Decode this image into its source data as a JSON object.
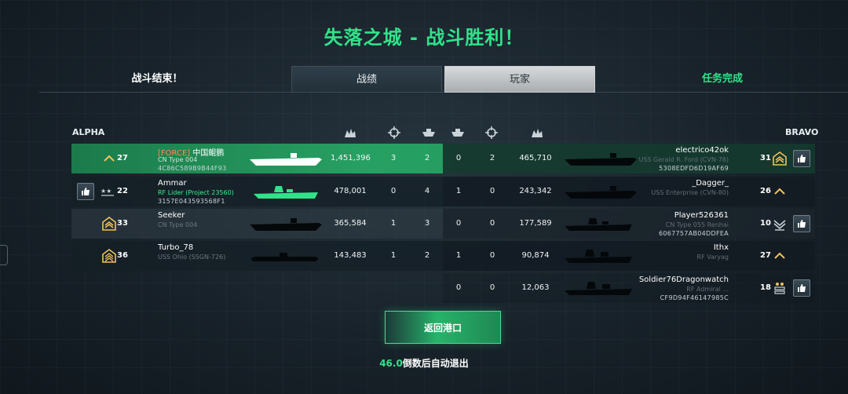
{
  "title": "失落之城 - 战斗胜利！",
  "tabs": {
    "battle_over": "战斗结束！",
    "stats": "战绩",
    "players": "玩家",
    "mission_complete": "任务完成"
  },
  "teams": {
    "alpha": "ALPHA",
    "bravo": "BRAVO"
  },
  "columns_icons": [
    "damage-icon",
    "crosshair-icon",
    "ship-icon",
    "ship-icon",
    "crosshair-icon",
    "damage-icon"
  ],
  "rows": [
    {
      "left": {
        "level": "27",
        "clan": "[FORCE]",
        "name": "中国鲲鹏",
        "ship": "CN Type 004",
        "id": "4C86C589B9B44F93",
        "damage": "1,451,396",
        "kills": "3",
        "assists": "2"
      },
      "right": {
        "assists": "0",
        "kills": "2",
        "damage": "465,710",
        "name": "electrico42ok",
        "ship": "USS Gerald R. Ford (CVN-78)",
        "id": "5308EDFD6D19AF69",
        "level": "31"
      }
    },
    {
      "left": {
        "level": "22",
        "clan": "",
        "name": "Ammar",
        "ship": "RF Lider (Project 23560)",
        "id": "3157E043593568F1",
        "damage": "478,001",
        "kills": "0",
        "assists": "4"
      },
      "right": {
        "assists": "1",
        "kills": "0",
        "damage": "243,342",
        "name": "_Dagger_",
        "ship": "USS Enterprise (CVN-80)",
        "id": "",
        "level": "26"
      }
    },
    {
      "left": {
        "level": "33",
        "clan": "",
        "name": "Seeker",
        "ship": "CN Type 004",
        "id": "",
        "damage": "365,584",
        "kills": "1",
        "assists": "3"
      },
      "right": {
        "assists": "0",
        "kills": "0",
        "damage": "177,589",
        "name": "Player526361",
        "ship": "CN Type 055 Renhai",
        "id": "6067757AB04DDFEA",
        "level": "10"
      }
    },
    {
      "left": {
        "level": "36",
        "clan": "",
        "name": "Turbo_78",
        "ship": "USS Ohio (SSGN-726)",
        "id": "",
        "damage": "143,483",
        "kills": "1",
        "assists": "2"
      },
      "right": {
        "assists": "1",
        "kills": "0",
        "damage": "90,874",
        "name": "Ithx",
        "ship": "RF Varyag",
        "id": "",
        "level": "27"
      }
    },
    {
      "right": {
        "assists": "0",
        "kills": "0",
        "damage": "12,063",
        "name": "Soldier76Dragonwatch",
        "ship": "RF Admiral ...",
        "id": "CF9D94F46147985C",
        "level": "18"
      }
    }
  ],
  "return_button": "返回港口",
  "countdown": {
    "seconds": "46.0",
    "text": "倒数后自动退出"
  },
  "colors": {
    "accent": "#31e28a",
    "self_row": "#27a163",
    "clan": "#ff8a4a"
  }
}
